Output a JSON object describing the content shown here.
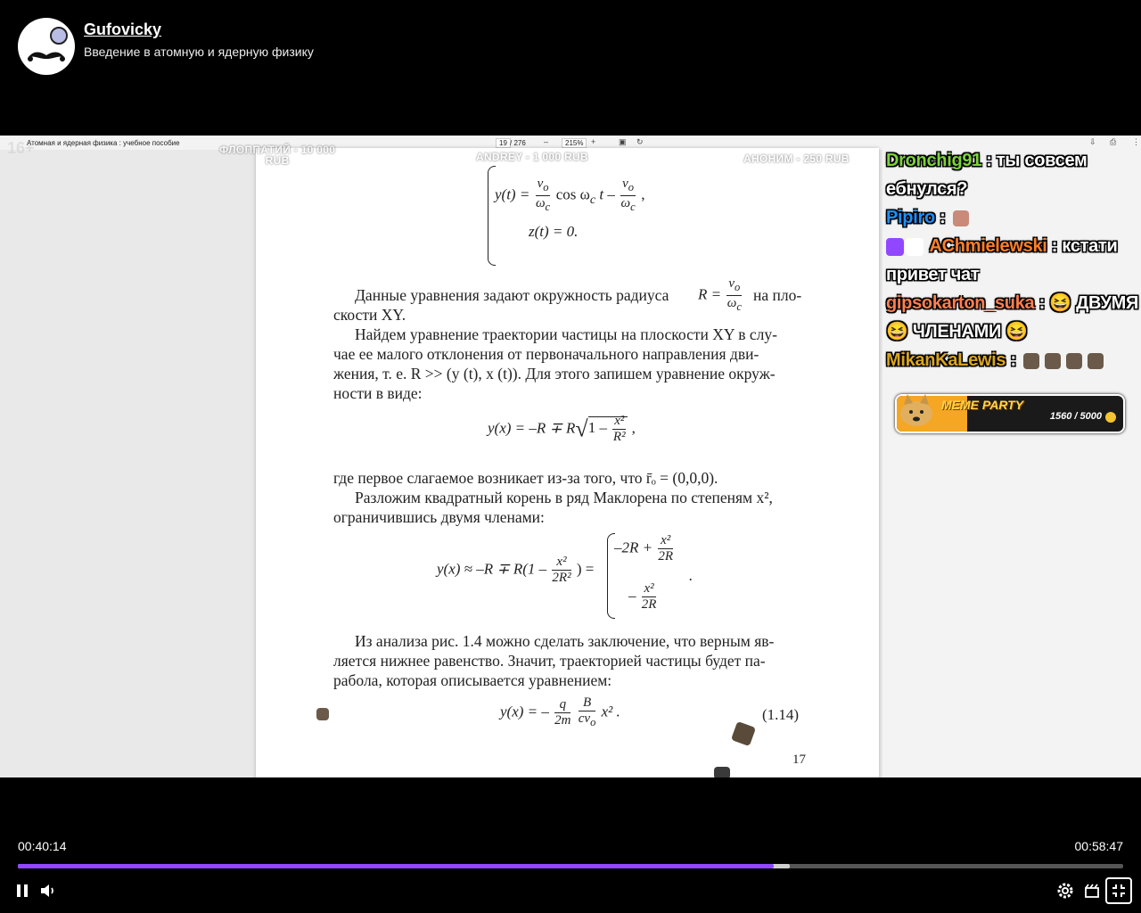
{
  "header": {
    "channel_name": "Gufovicky",
    "video_title": "Введение в атомную и ядерную физику"
  },
  "pdf_viewer": {
    "doc_title": "Атомная и ядерная физика : учебное пособие",
    "page_current": "19",
    "page_total": "/ 276",
    "zoom": "215%",
    "zoom_out": "–",
    "zoom_in": "+"
  },
  "overlay": {
    "age_mark": "16+",
    "donations": [
      {
        "name": "ФЛОППАТИЙ - 10 000",
        "amount": "RUB"
      },
      {
        "name": "ANDREY - 1 000 RUB",
        "amount": ""
      },
      {
        "name": "АНОНИМ - 250 RUB",
        "amount": ""
      }
    ]
  },
  "page": {
    "eq_y": {
      "lhs": "y(t) =",
      "n1": "v",
      "n1sub": "o",
      "d1": "ω",
      "d1sub": "c",
      "mid": "cos ω",
      "midsub": "c",
      "t": "t –",
      "n2": "v",
      "n2sub": "o",
      "d2": "ω",
      "d2sub": "c",
      "end": ","
    },
    "eq_z": "z(t) = 0.",
    "p1a": "Данные уравнения задают окружность радиуса",
    "p1_R": "R =",
    "p1_num": "v",
    "p1_numsub": "o",
    "p1_den": "ω",
    "p1_densub": "c",
    "p1b": "на пло-",
    "p1c": "скости XY.",
    "p2": [
      "Найдем уравнение траектории частицы на плоскости XY в слу-",
      "чае ее малого отклонения от первоначального направления дви-",
      "жения, т. е. R >> (y (t), x (t)). Для этого запишем уравнение окруж-",
      "ности в виде:"
    ],
    "eq2": {
      "lhs": "y(x) = –R ∓ R",
      "root": "1 –",
      "num": "x²",
      "den": "R²",
      "end": ","
    },
    "p3": "где первое слагаемое возникает из-за того, что  r̄ₒ  = (0,0,0).",
    "p4": [
      "Разложим квадратный корень в ряд Маклорена по степеням x²,",
      "ограничившись двумя членами:"
    ],
    "eq3": {
      "lhs": "y(x) ≈ –R ∓ R(1 –",
      "num": "x²",
      "den": "2R²",
      "mid": ") =",
      "c1": "–2R +",
      "c1num": "x²",
      "c1den": "2R",
      "c2": "–",
      "c2num": "x²",
      "c2den": "2R",
      "end": "."
    },
    "p5": [
      "Из анализа рис. 1.4 можно сделать заключение, что верным яв-",
      "ляется нижнее равенство. Значит, траекторией частицы будет па-",
      "рабола, которая описывается уравнением:"
    ],
    "eq4": {
      "lhs": "y(x) = –",
      "n1": "q",
      "d1": "2m",
      "n2": "B",
      "d2": "cv",
      "d2sub": "o",
      "end": "x² ."
    },
    "eq4_number": "(1.14)",
    "page_number": "17"
  },
  "chat": [
    {
      "user": "Dronchig91",
      "color": "#7cd23a",
      "text": " : ты совсем ебнулся?",
      "emotes": 0
    },
    {
      "user": "Pipiro",
      "color": "#1e90ff",
      "text": " : ",
      "emotes": 1
    },
    {
      "user": "AChmielewski",
      "color": "#ff7f27",
      "text": " : кстати привет чат",
      "emotes": 0,
      "badges": 2
    },
    {
      "user": "gipsokarton_suka",
      "color": "#ff7f50",
      "text": " : 😆 ДВУМЯ 😆 ЧЛЕНАМИ 😆",
      "emotes": 0
    },
    {
      "user": "MikanKaLewis",
      "color": "#daa520",
      "text": " : ",
      "emotes": 4
    }
  ],
  "widget": {
    "label": "MEME PARTY",
    "count": "1560 / 5000",
    "progress": 0.312
  },
  "player": {
    "current_time": "00:40:14",
    "duration": "00:58:47",
    "played_fraction": 0.684,
    "buffered_fraction": 0.698
  }
}
